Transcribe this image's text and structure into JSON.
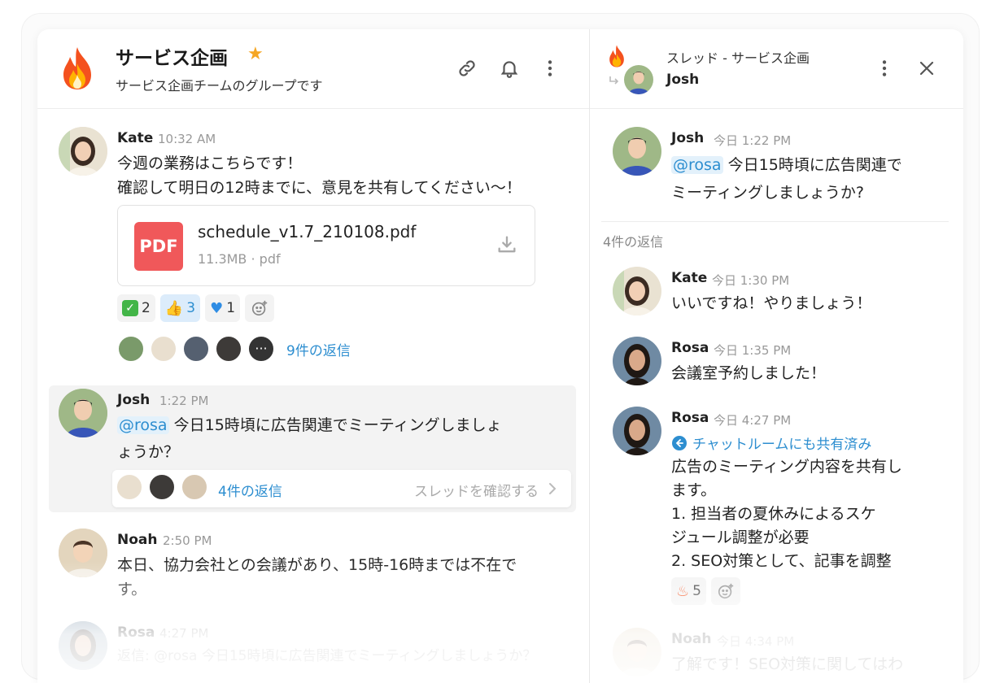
{
  "channel": {
    "title": "サービス企画",
    "description": "サービス企画チームのグループです"
  },
  "messages": [
    {
      "name": "Kate",
      "time": "10:32 AM",
      "line1": "今週の業務はこちらです！",
      "line2": "確認して明日の12時までに、意見を共有してください〜！",
      "file": {
        "badge": "PDF",
        "name": "schedule_v1.7_210108.pdf",
        "meta": "11.3MB · pdf"
      },
      "reactions": [
        {
          "emoji": "check-mark-emoji",
          "count": "2"
        },
        {
          "emoji": "thumbs-up-emoji",
          "count": "3"
        },
        {
          "emoji": "blue-heart-emoji",
          "count": "1"
        }
      ],
      "replies": "9件の返信"
    },
    {
      "name": "Josh",
      "time": "1:22 PM",
      "mention": "@rosa",
      "line1": " 今日15時頃に広告関連でミーティングしましょ",
      "line2": "ょうか？",
      "replies": "4件の返信",
      "view_thread": "スレッドを確認する"
    },
    {
      "name": "Noah",
      "time": "2:50 PM",
      "line1": "本日、協力会社との会議があり、15時-16時までは不在で",
      "line2": "す。"
    },
    {
      "name": "Rosa",
      "time": "4:27 PM",
      "line1": "返信: @rosa 今日15時頃に広告関連でミーティングしましょうか？"
    }
  ],
  "thread": {
    "title": "スレッド - サービス企画",
    "subtitle": "Josh",
    "parent": {
      "name": "Josh",
      "time": "今日 1:22 PM",
      "mention": "@rosa",
      "line1": " 今日15時頃に広告関連で",
      "line2": "ミーティングしましょうか?"
    },
    "reply_count": "4件の返信",
    "replies": [
      {
        "name": "Kate",
        "time": "今日 1:30 PM",
        "text": "いいですね！やりましょう！"
      },
      {
        "name": "Rosa",
        "time": "今日 1:35 PM",
        "text": "会議室予約しました！"
      },
      {
        "name": "Rosa",
        "time": "今日 4:27 PM",
        "shared": "チャットルームにも共有済み",
        "text": "広告のミーティング内容を共有し\nます。\n1. 担当者の夏休みによるスケ\nジュール調整が必要\n2. SEO対策として、記事を調整",
        "reaction_count": "5"
      },
      {
        "name": "Noah",
        "time": "今日 4:34 PM",
        "text": "了解です！SEO対策に関してはわ"
      }
    ]
  },
  "colors": {
    "accent": "#2d8ed0",
    "pdf": "#f0585a",
    "star": "#f5a623"
  }
}
